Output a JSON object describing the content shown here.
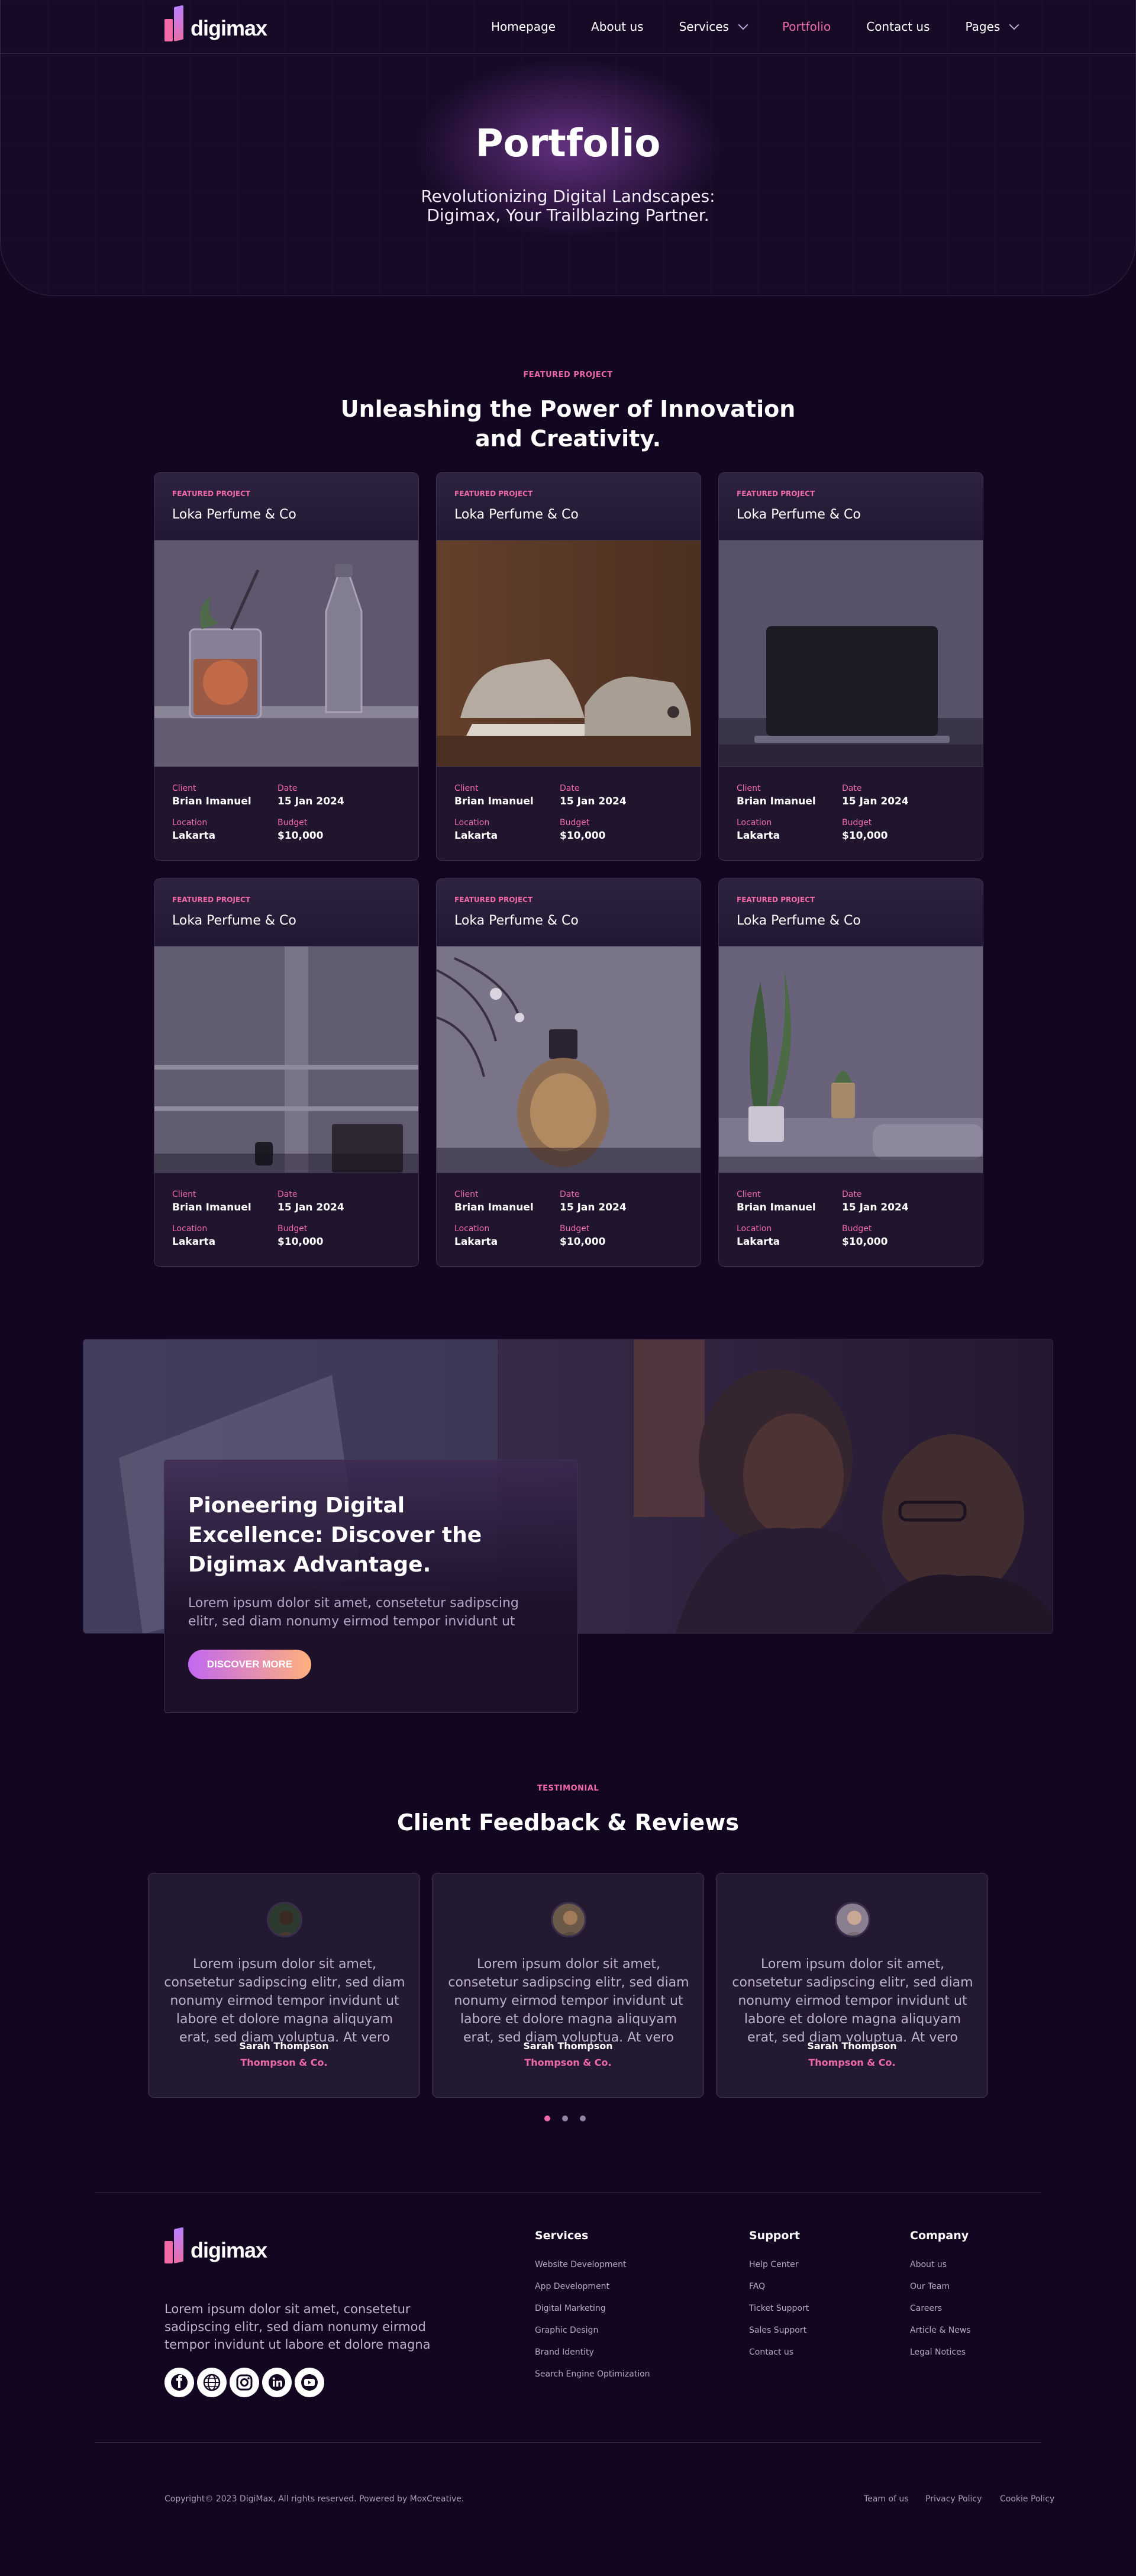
{
  "brand": {
    "name": "digimax"
  },
  "nav": {
    "items": [
      {
        "label": "Homepage",
        "active": false,
        "dropdown": false
      },
      {
        "label": "About us",
        "active": false,
        "dropdown": false
      },
      {
        "label": "Services",
        "active": false,
        "dropdown": true
      },
      {
        "label": "Portfolio",
        "active": true,
        "dropdown": false
      },
      {
        "label": "Contact us",
        "active": false,
        "dropdown": false
      },
      {
        "label": "Pages",
        "active": false,
        "dropdown": true
      }
    ]
  },
  "hero": {
    "title": "Portfolio",
    "subtitle": "Revolutionizing Digital Landscapes: Digimax, Your Trailblazing Partner."
  },
  "featured": {
    "eyebrow": "FEATURED PROJECT",
    "title": "Unleashing the Power of Innovation and Creativity.",
    "projects": [
      {
        "tag": "FEATURED PROJECT",
        "name": "Loka Perfume & Co",
        "image": "cocktail-glass-image",
        "client_label": "Client",
        "client": "Brian Imanuel",
        "date_label": "Date",
        "date": "15 Jan 2024",
        "location_label": "Location",
        "location": "Lakarta",
        "budget_label": "Budget",
        "budget": "$10,000"
      },
      {
        "tag": "FEATURED PROJECT",
        "name": "Loka Perfume & Co",
        "image": "sneakers-image",
        "client_label": "Client",
        "client": "Brian Imanuel",
        "date_label": "Date",
        "date": "15 Jan 2024",
        "location_label": "Location",
        "location": "Lakarta",
        "budget_label": "Budget",
        "budget": "$10,000"
      },
      {
        "tag": "FEATURED PROJECT",
        "name": "Loka Perfume & Co",
        "image": "laptop-image",
        "client_label": "Client",
        "client": "Brian Imanuel",
        "date_label": "Date",
        "date": "15 Jan 2024",
        "location_label": "Location",
        "location": "Lakarta",
        "budget_label": "Budget",
        "budget": "$10,000"
      },
      {
        "tag": "FEATURED PROJECT",
        "name": "Loka Perfume & Co",
        "image": "office-desk-image",
        "client_label": "Client",
        "client": "Brian Imanuel",
        "date_label": "Date",
        "date": "15 Jan 2024",
        "location_label": "Location",
        "location": "Lakarta",
        "budget_label": "Budget",
        "budget": "$10,000"
      },
      {
        "tag": "FEATURED PROJECT",
        "name": "Loka Perfume & Co",
        "image": "perfume-bottle-image",
        "client_label": "Client",
        "client": "Brian Imanuel",
        "date_label": "Date",
        "date": "15 Jan 2024",
        "location_label": "Location",
        "location": "Lakarta",
        "budget_label": "Budget",
        "budget": "$10,000"
      },
      {
        "tag": "FEATURED PROJECT",
        "name": "Loka Perfume & Co",
        "image": "plant-room-image",
        "client_label": "Client",
        "client": "Brian Imanuel",
        "date_label": "Date",
        "date": "15 Jan 2024",
        "location_label": "Location",
        "location": "Lakarta",
        "budget_label": "Budget",
        "budget": "$10,000"
      }
    ]
  },
  "banner": {
    "title": "Pioneering Digital Excellence: Discover the Digimax Advantage.",
    "text": "Lorem ipsum dolor sit amet, consetetur sadipscing elitr, sed diam nonumy eirmod tempor invidunt ut",
    "button": "DISCOVER MORE"
  },
  "testimonials": {
    "eyebrow": "TESTIMONIAL",
    "title": "Client Feedback & Reviews",
    "items": [
      {
        "text": "Lorem ipsum dolor sit amet, consetetur sadipscing elitr, sed diam nonumy eirmod tempor invidunt ut labore et dolore magna aliquyam erat, sed diam voluptua. At vero",
        "name": "Sarah Thompson",
        "company": "Thompson & Co."
      },
      {
        "text": "Lorem ipsum dolor sit amet, consetetur sadipscing elitr, sed diam nonumy eirmod tempor invidunt ut labore et dolore magna aliquyam erat, sed diam voluptua. At vero",
        "name": "Sarah Thompson",
        "company": "Thompson & Co."
      },
      {
        "text": "Lorem ipsum dolor sit amet, consetetur sadipscing elitr, sed diam nonumy eirmod tempor invidunt ut labore et dolore magna aliquyam erat, sed diam voluptua. At vero",
        "name": "Sarah Thompson",
        "company": "Thompson & Co."
      }
    ],
    "active_dot": 0
  },
  "footer": {
    "description": "Lorem ipsum dolor sit amet, consetetur sadipscing elitr, sed diam nonumy eirmod tempor invidunt ut labore et dolore magna",
    "social": [
      "facebook-icon",
      "globe-icon",
      "instagram-icon",
      "linkedin-icon",
      "youtube-icon"
    ],
    "columns": [
      {
        "title": "Services",
        "links": [
          "Website Development",
          "App Development",
          "Digital Marketing",
          "Graphic Design",
          "Brand Identity",
          "Search Engine Optimization"
        ]
      },
      {
        "title": "Support",
        "links": [
          "Help Center",
          "FAQ",
          "Ticket Support",
          "Sales Support",
          "Contact us"
        ]
      },
      {
        "title": "Company",
        "links": [
          "About us",
          "Our Team",
          "Careers",
          "Article & News",
          "Legal Notices"
        ]
      }
    ],
    "copyright": "Copyright© 2023 DigiMax, All rights reserved. Powered by MoxCreative.",
    "legal": [
      "Team of us",
      "Privacy Policy",
      "Cookie Policy"
    ]
  },
  "colors": {
    "background": "#120620",
    "accent": "#f06aa8",
    "card": "#1e142c"
  }
}
